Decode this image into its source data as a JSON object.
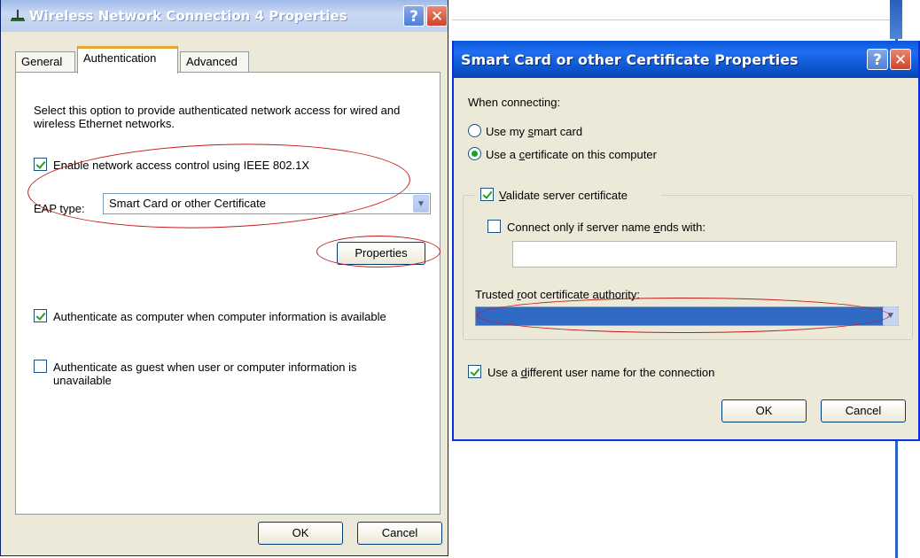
{
  "window1": {
    "title": "Wireless Network Connection 4 Properties",
    "help_glyph": "?",
    "close_glyph": "✕",
    "tabs": [
      {
        "label": "General"
      },
      {
        "label": "Authentication"
      },
      {
        "label": "Advanced"
      }
    ],
    "active_tab": "Authentication",
    "description": "Select this option to provide authenticated network access for wired and wireless Ethernet networks.",
    "enable_8021x": {
      "label": "Enable network access control using IEEE 802.1X",
      "checked": true
    },
    "eap_type_label": "EAP type:",
    "eap_type_value": "Smart Card or other Certificate",
    "properties_button": "Properties",
    "auth_computer": {
      "label": "Authenticate as computer when computer information is available",
      "checked": true
    },
    "auth_guest": {
      "label": "Authenticate as guest when user or computer information is unavailable",
      "checked": false
    },
    "ok_button": "OK",
    "cancel_button": "Cancel",
    "icon": "network-icon"
  },
  "window2": {
    "title": "Smart Card or other Certificate Properties",
    "help_glyph": "?",
    "close_glyph": "✕",
    "when_connecting_label": "When connecting:",
    "use_smart_card": {
      "label_pre": "Use my ",
      "label_ul": "s",
      "label_post": "mart card",
      "checked": false
    },
    "use_certificate": {
      "label_pre": "Use a ",
      "label_ul": "c",
      "label_post": "ertificate on this computer",
      "checked": true
    },
    "validate_server": {
      "label_ul": "V",
      "label_post": "alidate server certificate",
      "checked": true
    },
    "connect_only": {
      "label_pre": "Connect only if server name ",
      "label_ul": "e",
      "label_post": "nds with:",
      "checked": false
    },
    "server_name_value": "",
    "trusted_root_label_pre": "Trusted ",
    "trusted_root_label_ul": "r",
    "trusted_root_label_post": "oot certificate authority:",
    "different_user": {
      "label_pre": "Use a ",
      "label_ul": "d",
      "label_post": "ifferent user name for the connection",
      "checked": true
    },
    "ok_button": "OK",
    "cancel_button": "Cancel"
  },
  "colors": {
    "annotation_ellipse": "#c41a1a",
    "selection_blue": "#316ac5",
    "titlebar_active": "#0a58d8"
  }
}
